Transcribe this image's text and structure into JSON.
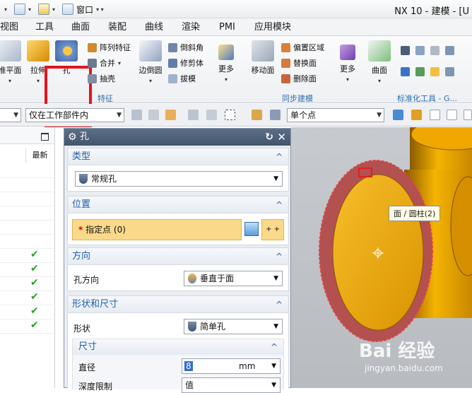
{
  "window": {
    "title": "NX 10 - 建模 - [U"
  },
  "quick_access": {
    "window_menu": "窗口"
  },
  "menu_tabs": [
    "视图",
    "工具",
    "曲面",
    "装配",
    "曲线",
    "渲染",
    "PMI",
    "应用模块"
  ],
  "ribbon": {
    "datum_plane": "准平面",
    "extrude": "拉伸",
    "hole": "孔",
    "pattern_feature": "阵列特征",
    "unite": "合并",
    "shell": "抽壳",
    "edge_blend": "边倒圆",
    "chamfer": "倒斜角",
    "trim_body": "修剪体",
    "draft": "拔模",
    "more_1": "更多",
    "move_face": "移动面",
    "offset_region": "偏置区域",
    "replace_face": "替换面",
    "delete_face": "删除面",
    "more_2": "更多",
    "surface": "曲面",
    "groups": {
      "feature": "特征",
      "sync_modeling": "同步建模",
      "standard_tools": "标准化工具 - G..."
    }
  },
  "filter_bar": {
    "scope": "仅在工作部件内",
    "snap": "单个点"
  },
  "navigator": {
    "column_latest": "最新",
    "checked_rows": [
      6,
      7,
      8,
      9,
      10,
      11
    ]
  },
  "dialog": {
    "title": "孔",
    "sections": {
      "type": {
        "title": "类型",
        "value": "常规孔"
      },
      "location": {
        "title": "位置",
        "specify_point": "指定点 (0)"
      },
      "direction": {
        "title": "方向",
        "label": "孔方向",
        "value": "垂直于面"
      },
      "form": {
        "title": "形状和尺寸",
        "shape_label": "形状",
        "shape_value": "简单孔"
      },
      "dimensions": {
        "title": "尺寸",
        "diameter_label": "直径",
        "diameter_value": "8",
        "diameter_unit": "mm",
        "depth_label": "深度限制",
        "depth_value": "值"
      }
    }
  },
  "viewport": {
    "tooltip": "面 / 圆柱(2)",
    "watermark": "Bai 经验",
    "watermark_url": "jingyan.baidu.com"
  },
  "colors": {
    "accent": "#1f5fa8",
    "highlight": "#e4131b",
    "part": "#f0a800",
    "selected_face": "#b35050",
    "point_bg": "#fad98a"
  }
}
